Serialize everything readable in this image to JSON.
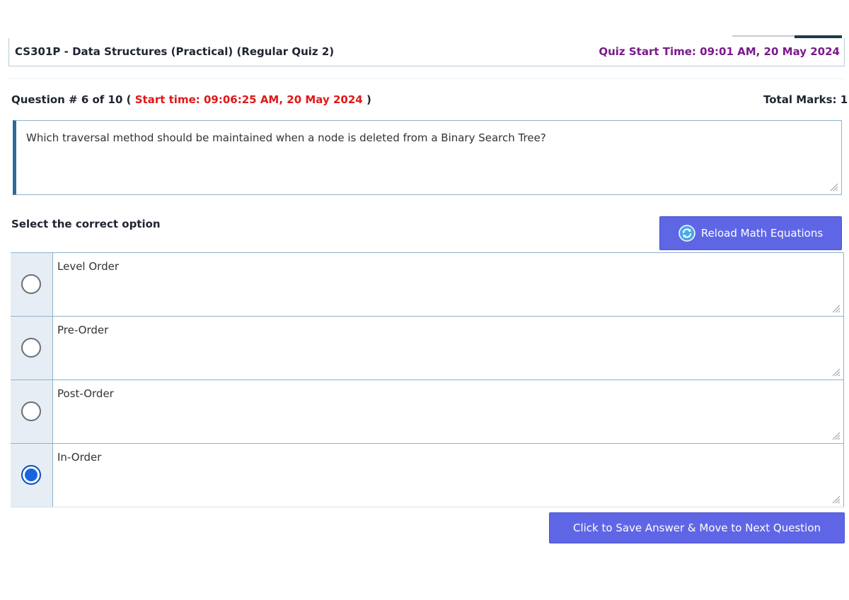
{
  "header": {
    "course_title": "CS301P - Data Structures (Practical) (Regular Quiz 2)",
    "quiz_start_time": "Quiz Start Time: 09:01 AM, 20 May 2024"
  },
  "question": {
    "number_label": "Question # 6 of 10 (",
    "start_time": "Start time: 09:06:25 AM, 20 May 2024",
    "close_paren": ")",
    "total_marks": "Total Marks: 1",
    "text": "Which traversal method should be maintained when a node is deleted from a Binary Search Tree?"
  },
  "options_section": {
    "select_label": "Select the correct option",
    "reload_label": "Reload Math Equations",
    "options": [
      {
        "label": "Level Order",
        "selected": false
      },
      {
        "label": "Pre-Order",
        "selected": false
      },
      {
        "label": "Post-Order",
        "selected": false
      },
      {
        "label": "In-Order",
        "selected": true
      }
    ]
  },
  "actions": {
    "save_label": "Click to Save Answer & Move to Next Question"
  },
  "colors": {
    "accent_button": "#5f66e6",
    "quiz_start_text": "#7a1a8a",
    "start_time_text": "#e01818",
    "selected_radio": "#1565e0"
  },
  "icons": {
    "reload": "refresh-icon",
    "resize": "resize-grip-icon"
  }
}
